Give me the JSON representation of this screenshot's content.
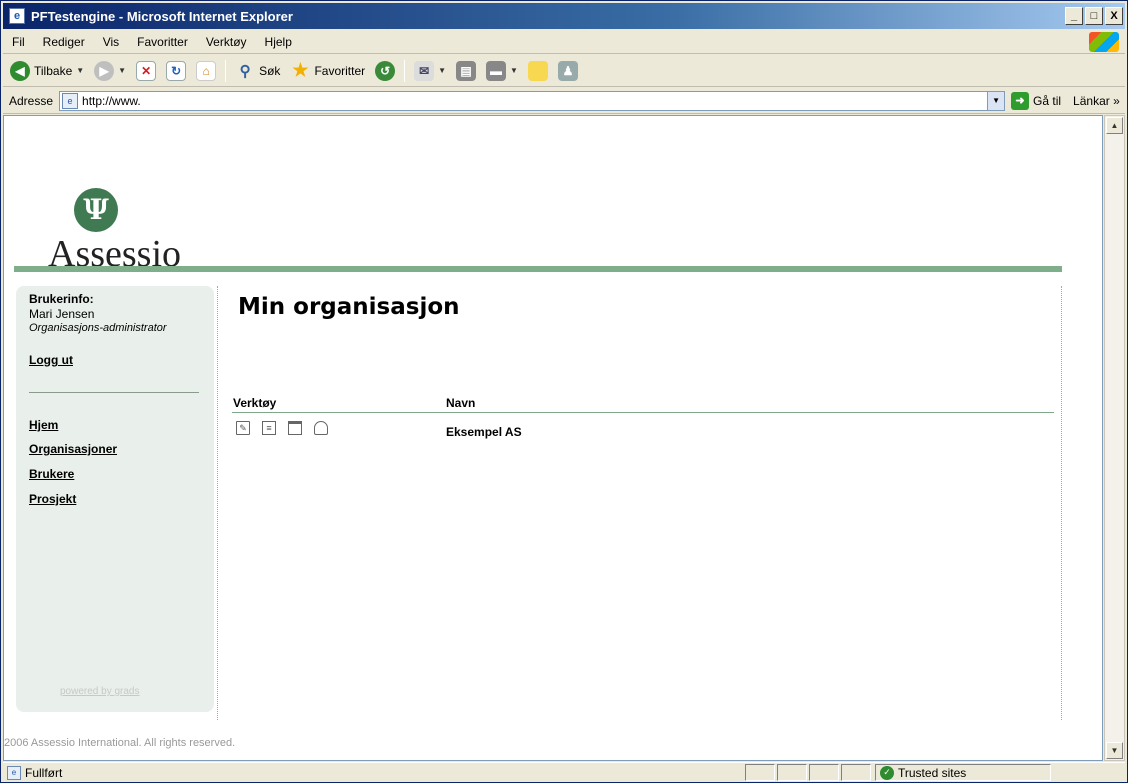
{
  "window": {
    "title": "PFTestengine - Microsoft Internet Explorer",
    "controls": {
      "minimize": "_",
      "maximize": "□",
      "close": "X"
    }
  },
  "menu": [
    "Fil",
    "Rediger",
    "Vis",
    "Favoritter",
    "Verktøy",
    "Hjelp"
  ],
  "toolbar": {
    "back_label": "Tilbake",
    "search_label": "Søk",
    "favorites_label": "Favoritter"
  },
  "address": {
    "label": "Adresse",
    "url": "http://www.",
    "go_label": "Gå til",
    "links_label": "Länkar",
    "links_more": "»"
  },
  "page": {
    "logo_text": "Assessio",
    "logo_symbol": "Ψ",
    "userinfo_title": "Brukerinfo:",
    "user_name": "Mari Jensen",
    "user_role": "Organisasjons-administrator",
    "logout_label": "Logg ut",
    "nav": [
      "Hjem",
      "Organisasjoner",
      "Brukere",
      "Prosjekt"
    ],
    "powered_by": "powered by grads",
    "heading": "Min organisasjon",
    "table": {
      "headers": {
        "tools": "Verktøy",
        "name": "Navn"
      },
      "rows": [
        {
          "name": "Eksempel AS"
        }
      ]
    },
    "footer": "2006 Assessio International. All rights reserved."
  },
  "status": {
    "text": "Fullført",
    "zone": "Trusted sites"
  },
  "icons": [
    "ie-page-icon",
    "back-icon",
    "forward-icon",
    "stop-icon",
    "refresh-icon",
    "home-icon",
    "search-icon",
    "favorites-star-icon",
    "history-icon",
    "mail-icon",
    "print-icon",
    "edit-icon",
    "messenger-icon",
    "go-arrow-icon",
    "windows-flag-icon",
    "checkmark-icon"
  ]
}
